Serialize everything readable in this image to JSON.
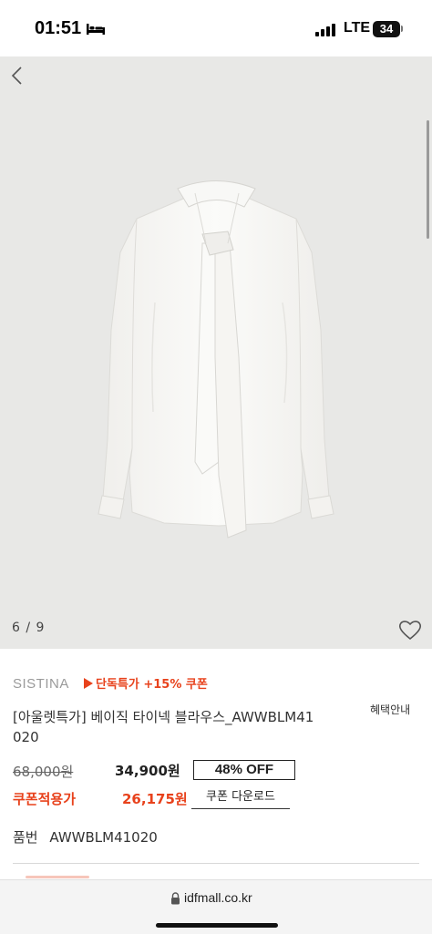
{
  "status_bar": {
    "time": "01:51",
    "network": "LTE",
    "battery": "34"
  },
  "gallery": {
    "page_indicator": "6 / 9",
    "icons": [
      "chevron-left-icon",
      "heart-icon"
    ]
  },
  "product": {
    "brand": "SISTINA",
    "promo": "단독특가 +15% 쿠폰",
    "title_line1": "[아울렛특가] 베이직 타이넥 블라우스_AWWBLM41",
    "title_line2": "020",
    "benefit_button": "혜택안내",
    "original_price": "68,000원",
    "sale_price": "34,900원",
    "discount_badge": "48% OFF",
    "coupon_label": "쿠폰적용가",
    "coupon_price": "26,175원",
    "coupon_download": "쿠폰 다운로드",
    "sku_label": "품번",
    "sku_value": "AWWBLM41020"
  },
  "browser": {
    "url": "idfmall.co.kr"
  },
  "colors": {
    "accent": "#e8421c",
    "gallery_background": "#e8e8e6"
  }
}
